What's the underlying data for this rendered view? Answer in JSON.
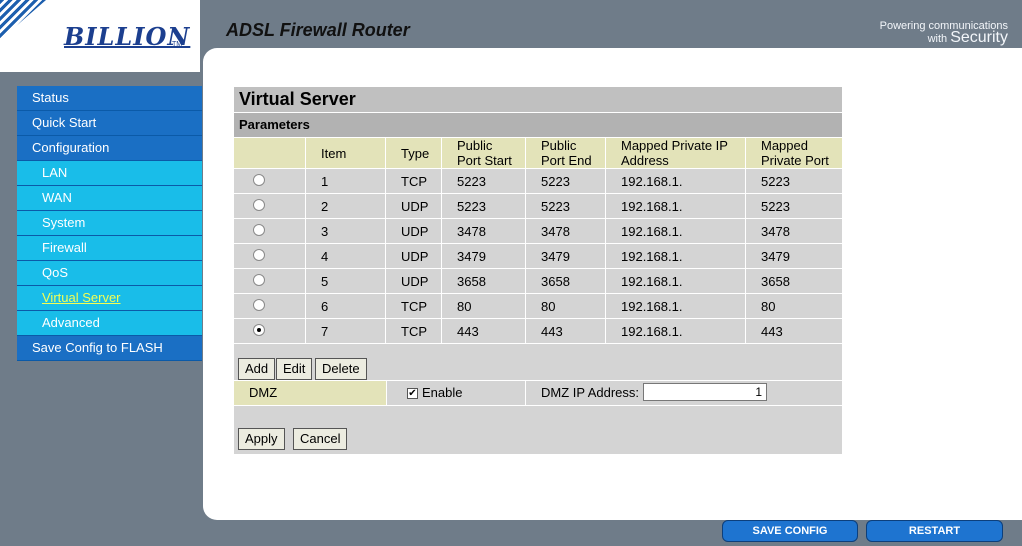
{
  "header": {
    "logo": "BILLION",
    "logo_tm": "TM",
    "title": "ADSL Firewall Router",
    "tagline_powering": "Powering communications",
    "tagline_with": "with",
    "tagline_security": "Security"
  },
  "sidebar": {
    "items": [
      {
        "label": "Status",
        "level": "top"
      },
      {
        "label": "Quick Start",
        "level": "top"
      },
      {
        "label": "Configuration",
        "level": "top"
      },
      {
        "label": "LAN",
        "level": "sub"
      },
      {
        "label": "WAN",
        "level": "sub"
      },
      {
        "label": "System",
        "level": "sub"
      },
      {
        "label": "Firewall",
        "level": "sub"
      },
      {
        "label": "QoS",
        "level": "sub"
      },
      {
        "label": "Virtual Server",
        "level": "sub",
        "active": true
      },
      {
        "label": "Advanced",
        "level": "sub"
      },
      {
        "label": "Save Config to FLASH",
        "level": "top"
      }
    ]
  },
  "content": {
    "title": "Virtual Server",
    "params_label": "Parameters",
    "columns": [
      "",
      "Item",
      "Type",
      "Public Port Start",
      "Public Port End",
      "Mapped Private IP Address",
      "Mapped Private Port"
    ],
    "col_lines": {
      "pps1": "Public",
      "pps2": "Port Start",
      "ppe1": "Public",
      "ppe2": "Port End",
      "mip1": "Mapped Private IP",
      "mip2": "Address",
      "mpp1": "Mapped",
      "mpp2": "Private Port"
    },
    "rows": [
      {
        "item": "1",
        "type": "TCP",
        "start": "5223",
        "end": "5223",
        "ip": "192.168.1.",
        "port": "5223",
        "selected": false
      },
      {
        "item": "2",
        "type": "UDP",
        "start": "5223",
        "end": "5223",
        "ip": "192.168.1.",
        "port": "5223",
        "selected": false
      },
      {
        "item": "3",
        "type": "UDP",
        "start": "3478",
        "end": "3478",
        "ip": "192.168.1.",
        "port": "3478",
        "selected": false
      },
      {
        "item": "4",
        "type": "UDP",
        "start": "3479",
        "end": "3479",
        "ip": "192.168.1.",
        "port": "3479",
        "selected": false
      },
      {
        "item": "5",
        "type": "UDP",
        "start": "3658",
        "end": "3658",
        "ip": "192.168.1.",
        "port": "3658",
        "selected": false
      },
      {
        "item": "6",
        "type": "TCP",
        "start": "80",
        "end": "80",
        "ip": "192.168.1.",
        "port": "80",
        "selected": false
      },
      {
        "item": "7",
        "type": "TCP",
        "start": "443",
        "end": "443",
        "ip": "192.168.1.",
        "port": "443",
        "selected": true
      }
    ],
    "buttons": {
      "add": "Add",
      "edit": "Edit",
      "delete": "Delete"
    },
    "dmz": {
      "label": "DMZ",
      "enable_label": "Enable",
      "enabled": true,
      "ip_label": "DMZ IP Address:",
      "ip_value": "1"
    },
    "apply_label": "Apply",
    "cancel_label": "Cancel"
  },
  "footer": {
    "save_config": "SAVE CONFIG",
    "restart": "RESTART"
  }
}
